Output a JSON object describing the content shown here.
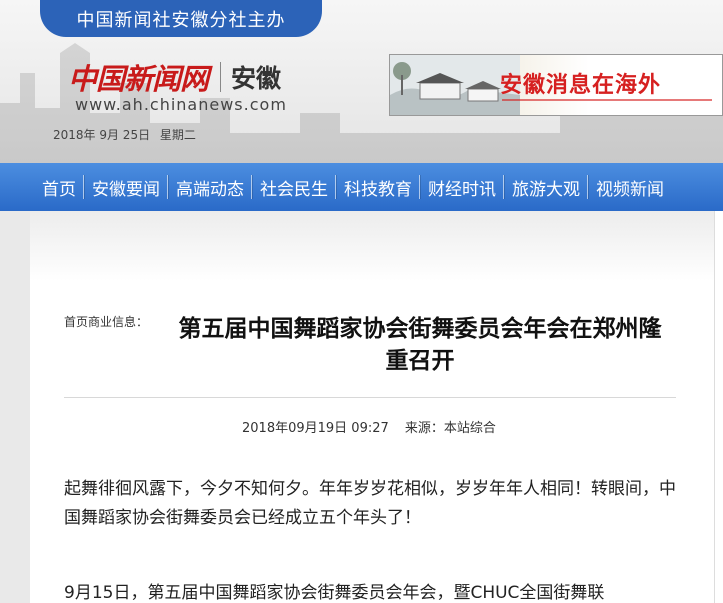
{
  "header": {
    "org_tab": "中国新闻社安徽分社主办",
    "logo_main": "中国新闻网",
    "logo_region": "安徽",
    "site_url": "www.ah.chinanews.com",
    "date": "2018年 9月 25日",
    "weekday": "星期二",
    "banner_text": "安徽消息在海外"
  },
  "nav": {
    "items": [
      {
        "label": "首页"
      },
      {
        "label": "安徽要闻"
      },
      {
        "label": "高端动态"
      },
      {
        "label": "社会民生"
      },
      {
        "label": "科技教育"
      },
      {
        "label": "财经时讯"
      },
      {
        "label": "旅游大观"
      },
      {
        "label": "视频新闻"
      }
    ]
  },
  "article": {
    "breadcrumb": "首页商业信息：",
    "title": "第五届中国舞蹈家协会街舞委员会年会在郑州隆重召开",
    "datetime": "2018年09月19日 09:27",
    "source": "来源：本站综合",
    "paragraphs": [
      "起舞徘徊风露下，今夕不知何夕。年年岁岁花相似，岁岁年年人相同！转眼间，中国舞蹈家协会街舞委员会已经成立五个年头了！",
      "9月15日，第五届中国舞蹈家协会街舞委员会年会，暨CHUC全国街舞联"
    ]
  },
  "colors": {
    "nav_blue": "#2a6ac8",
    "brand_red": "#c81a1a"
  }
}
